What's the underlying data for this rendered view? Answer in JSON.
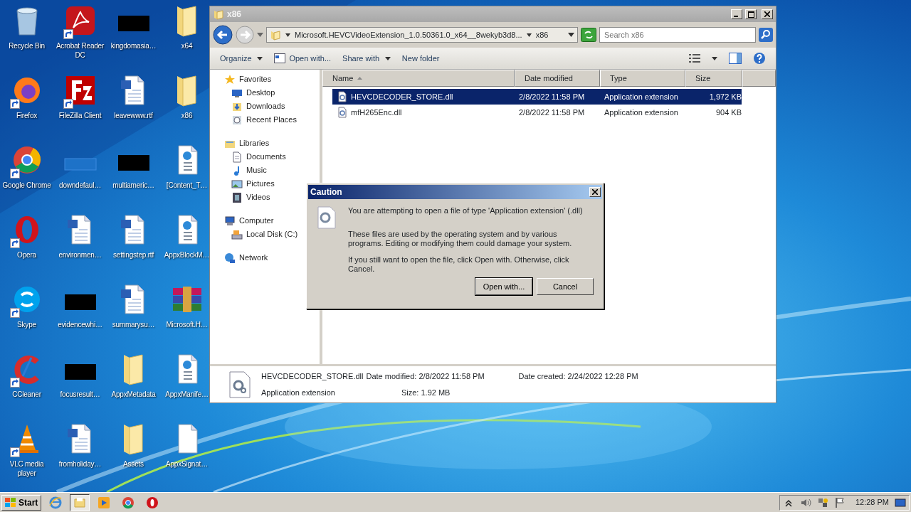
{
  "desktop_icons": [
    {
      "label": "Recycle Bin",
      "kind": "recycle",
      "shortcut": false
    },
    {
      "label": "Firefox",
      "kind": "firefox",
      "shortcut": true
    },
    {
      "label": "Google Chrome",
      "kind": "chrome",
      "shortcut": true
    },
    {
      "label": "Opera",
      "kind": "opera",
      "shortcut": true
    },
    {
      "label": "Skype",
      "kind": "skype",
      "shortcut": true
    },
    {
      "label": "CCleaner",
      "kind": "ccleaner",
      "shortcut": true
    },
    {
      "label": "VLC media player",
      "kind": "vlc",
      "shortcut": true
    },
    {
      "label": "Acrobat Reader DC",
      "kind": "pdf",
      "shortcut": true
    },
    {
      "label": "FileZilla Client",
      "kind": "filezilla",
      "shortcut": true
    },
    {
      "label": "downdefaul…",
      "kind": "faint",
      "shortcut": false
    },
    {
      "label": "environmen…",
      "kind": "word",
      "shortcut": false
    },
    {
      "label": "evidencewhi…",
      "kind": "black",
      "shortcut": false
    },
    {
      "label": "focusresult…",
      "kind": "black",
      "shortcut": false
    },
    {
      "label": "fromholiday…",
      "kind": "word",
      "shortcut": false
    },
    {
      "label": "kingdomasia…",
      "kind": "black",
      "shortcut": false
    },
    {
      "label": "leavewww.rtf",
      "kind": "word",
      "shortcut": false
    },
    {
      "label": "multiameric…",
      "kind": "black",
      "shortcut": false
    },
    {
      "label": "settingstep.rtf",
      "kind": "word",
      "shortcut": false
    },
    {
      "label": "summarysu…",
      "kind": "word",
      "shortcut": false
    },
    {
      "label": "AppxMetadata",
      "kind": "folder",
      "shortcut": false
    },
    {
      "label": "Assets",
      "kind": "folder",
      "shortcut": false
    },
    {
      "label": "x64",
      "kind": "folder",
      "shortcut": false
    },
    {
      "label": "x86",
      "kind": "folder",
      "shortcut": false
    },
    {
      "label": "[Content_T…",
      "kind": "web",
      "shortcut": false
    },
    {
      "label": "AppxBlockM…",
      "kind": "web",
      "shortcut": false
    },
    {
      "label": "Microsoft.H…",
      "kind": "archive",
      "shortcut": false
    },
    {
      "label": "AppxManife…",
      "kind": "web",
      "shortcut": false
    },
    {
      "label": "AppxSignat…",
      "kind": "file",
      "shortcut": false
    }
  ],
  "explorer": {
    "title": "x86",
    "breadcrumb": [
      "Microsoft.HEVCVideoExtension_1.0.50361.0_x64__8wekyb3d8...",
      "x86"
    ],
    "search": {
      "placeholder": "Search x86"
    },
    "toolbar": [
      {
        "label": "Organize",
        "kind": "menu"
      },
      {
        "label": "Open with...",
        "kind": "icon"
      },
      {
        "label": "Share with",
        "kind": "menu"
      },
      {
        "label": "New folder",
        "kind": "plain"
      }
    ],
    "nav_pane": [
      {
        "label": "Favorites",
        "kind": "star",
        "children": [
          {
            "label": "Desktop",
            "kind": "desktop"
          },
          {
            "label": "Downloads",
            "kind": "downloads"
          },
          {
            "label": "Recent Places",
            "kind": "recent"
          }
        ]
      },
      {
        "label": "Libraries",
        "kind": "library",
        "children": [
          {
            "label": "Documents",
            "kind": "doc"
          },
          {
            "label": "Music",
            "kind": "music"
          },
          {
            "label": "Pictures",
            "kind": "pictures"
          },
          {
            "label": "Videos",
            "kind": "videos"
          }
        ]
      },
      {
        "label": "Computer",
        "kind": "computer",
        "children": [
          {
            "label": "Local Disk (C:)",
            "kind": "disk"
          }
        ]
      },
      {
        "label": "Network",
        "kind": "network"
      }
    ],
    "columns": [
      {
        "label": "Name",
        "sorted": true
      },
      {
        "label": "Date modified",
        "sorted": false
      },
      {
        "label": "Type",
        "sorted": false
      },
      {
        "label": "Size",
        "sorted": false
      }
    ],
    "files": [
      {
        "name": "HEVCDECODER_STORE.dll",
        "date": "2/8/2022 11:58 PM",
        "type": "Application extension",
        "size": "1,972 KB",
        "selected": true
      },
      {
        "name": "mfH265Enc.dll",
        "date": "2/8/2022 11:58 PM",
        "type": "Application extension",
        "size": "904 KB",
        "selected": false
      }
    ],
    "details": {
      "name": "HEVCDECODER_STORE.dll",
      "type": "Application extension",
      "modified_label": "Date modified:",
      "modified": "2/8/2022 11:58 PM",
      "size_label": "Size:",
      "size": "1.92 MB",
      "created_label": "Date created:",
      "created": "2/24/2022 12:28 PM"
    }
  },
  "dialog": {
    "title": "Caution",
    "message": "You are attempting to open a file of type 'Application extension' (.dll)",
    "body": "These files are used by the operating system and by various programs. Editing or modifying them could damage your system.",
    "hint": "If you still want to open the file, click Open with. Otherwise, click Cancel.",
    "buttons": [
      {
        "label": "Open with...",
        "default": true
      },
      {
        "label": "Cancel",
        "default": false
      }
    ]
  },
  "taskbar": {
    "start": "Start",
    "apps": [
      {
        "kind": "ie",
        "active": false
      },
      {
        "kind": "explorer",
        "active": true
      },
      {
        "kind": "media",
        "active": false
      },
      {
        "kind": "chrome",
        "active": false
      },
      {
        "kind": "opera",
        "active": false
      }
    ],
    "clock": "12:28 PM"
  }
}
